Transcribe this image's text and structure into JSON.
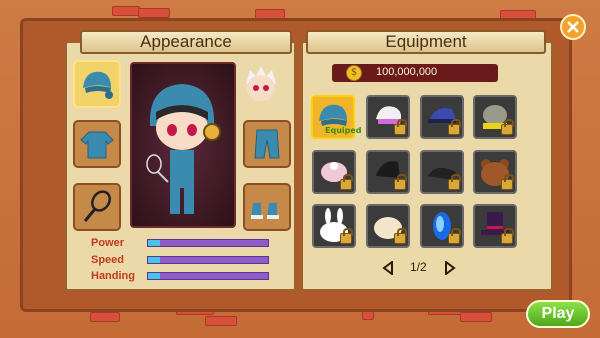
{
  "appearance": {
    "title": "Appearance"
  },
  "equipment": {
    "title": "Equipment",
    "gold": "100,000,000",
    "equipped_label": "Equiped"
  },
  "stats": [
    {
      "label": "Power",
      "value": 0.1
    },
    {
      "label": "Speed",
      "value": 0.1
    },
    {
      "label": "Handing",
      "value": 0.1
    }
  ],
  "pagination": {
    "text": "1/2"
  },
  "play": {
    "label": "Play"
  },
  "close": {
    "icon": "close-icon"
  },
  "colors": {
    "accent": "#6ec62e",
    "locked": "#d9a83a"
  }
}
